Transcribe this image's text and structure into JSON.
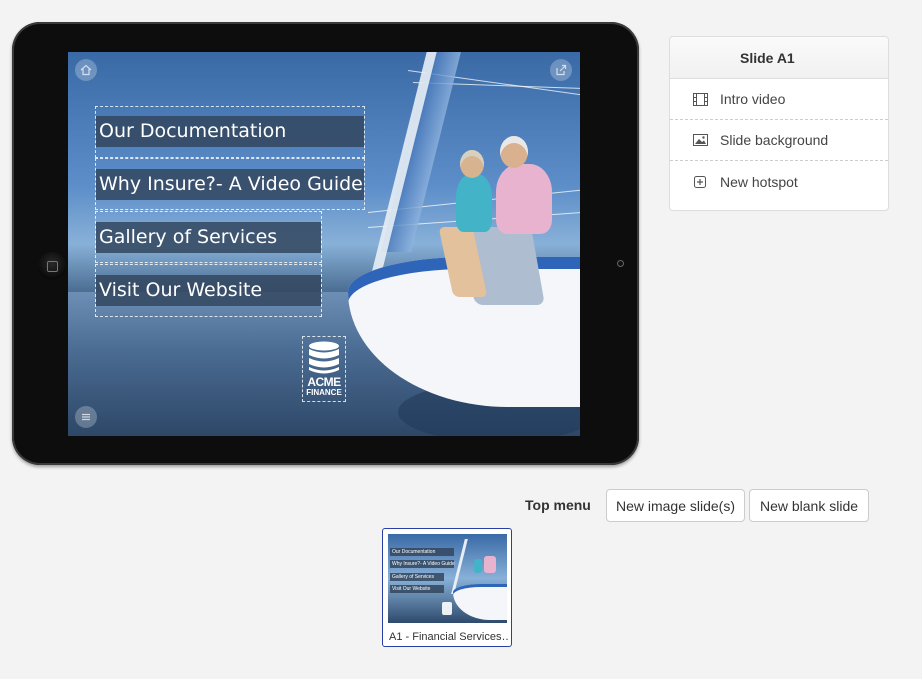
{
  "slide_screen": {
    "menu_items": [
      "Our Documentation",
      "Why Insure?- A Video Guide",
      "Gallery of Services",
      "Visit Our Website"
    ],
    "logo_line1": "ACME",
    "logo_line2": "FINANCE",
    "icons": [
      "home-icon",
      "share-icon",
      "menu-icon"
    ]
  },
  "panel": {
    "title": "Slide A1",
    "items": [
      {
        "label": "Intro video",
        "icon": "film-icon"
      },
      {
        "label": "Slide background",
        "icon": "image-icon"
      },
      {
        "label": "New hotspot",
        "icon": "plus-square-icon"
      }
    ]
  },
  "toolbar": {
    "top_menu_label": "Top menu",
    "new_image_slide": "New image slide(s)",
    "new_blank_slide": "New blank slide"
  },
  "thumbnail": {
    "caption": "A1 - Financial Services…",
    "items": [
      "Our Documentation",
      "Why Insure?- A Video Guide",
      "Gallery of Services",
      "Visit Our Website"
    ],
    "selected_border_color": "#2a3fa6"
  }
}
